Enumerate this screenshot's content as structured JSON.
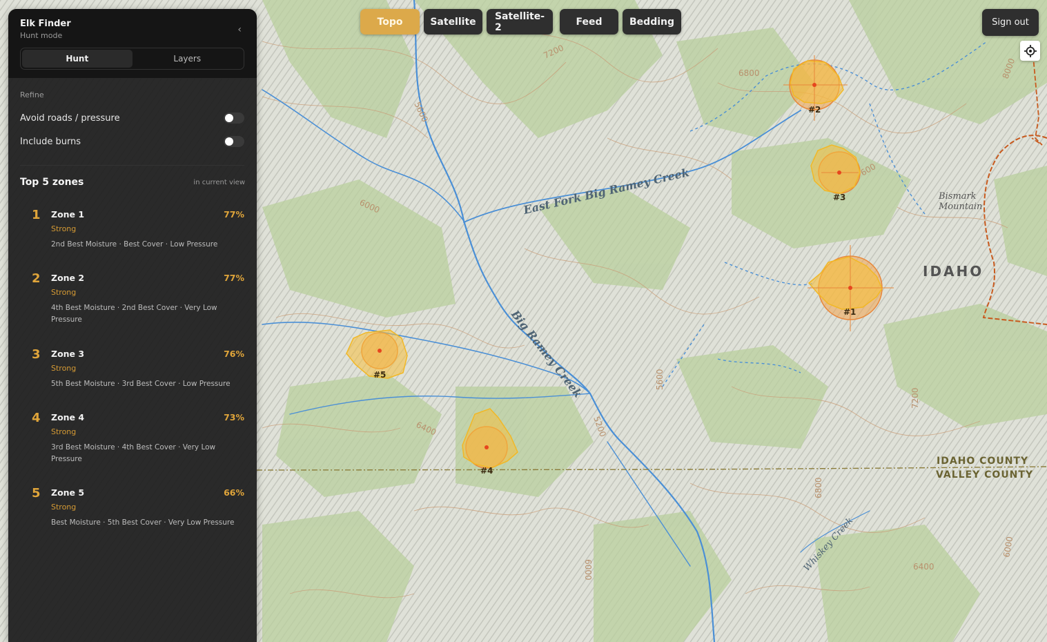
{
  "app": {
    "title": "Elk Finder",
    "mode": "Hunt mode"
  },
  "panel_tabs": [
    {
      "label": "Hunt",
      "active": true
    },
    {
      "label": "Layers",
      "active": false
    }
  ],
  "refine": {
    "heading": "Refine",
    "options": [
      {
        "label": "Avoid roads / pressure",
        "on": false
      },
      {
        "label": "Include burns",
        "on": false
      }
    ]
  },
  "zones": {
    "heading": "Top 5 zones",
    "scope": "in current view",
    "items": [
      {
        "rank": "1",
        "name": "Zone 1",
        "pct": "77%",
        "rating": "Strong",
        "desc": "2nd Best Moisture · Best Cover · Low Pressure"
      },
      {
        "rank": "2",
        "name": "Zone 2",
        "pct": "77%",
        "rating": "Strong",
        "desc": "4th Best Moisture · 2nd Best Cover · Very Low Pressure"
      },
      {
        "rank": "3",
        "name": "Zone 3",
        "pct": "76%",
        "rating": "Strong",
        "desc": "5th Best Moisture · 3rd Best Cover · Low Pressure"
      },
      {
        "rank": "4",
        "name": "Zone 4",
        "pct": "73%",
        "rating": "Strong",
        "desc": "3rd Best Moisture · 4th Best Cover · Very Low Pressure"
      },
      {
        "rank": "5",
        "name": "Zone 5",
        "pct": "66%",
        "rating": "Strong",
        "desc": "Best Moisture · 5th Best Cover · Very Low Pressure"
      }
    ]
  },
  "map_layers": [
    {
      "label": "Topo",
      "active": true
    },
    {
      "label": "Satellite",
      "active": false
    },
    {
      "label": "Satellite-2",
      "active": false
    },
    {
      "label": "Feed",
      "active": false
    },
    {
      "label": "Bedding",
      "active": false
    }
  ],
  "account": {
    "sign_out": "Sign out"
  },
  "map": {
    "creeks": {
      "east_fork": "East Fork Big Ramey Creek",
      "big_ramey": "Big Ramey Creek",
      "whiskey": "Whiskey Creek"
    },
    "state_label": "IDAHO",
    "mountain": [
      "Bismark",
      "Mountain"
    ],
    "county_north": "IDAHO COUNTY",
    "county_south": "VALLEY COUNTY",
    "contours": [
      "7200",
      "6800",
      "8000",
      "5600",
      "6000",
      "600",
      "5600",
      "6400",
      "5200",
      "7200",
      "6800",
      "6000",
      "6400",
      "6000"
    ],
    "markers": [
      "#1",
      "#2",
      "#3",
      "#4",
      "#5"
    ]
  },
  "colors": {
    "accent": "#dca94a",
    "zone_fill": "#f3b53c",
    "water": "#4a8fd6",
    "panel": "#1c1c1c"
  }
}
